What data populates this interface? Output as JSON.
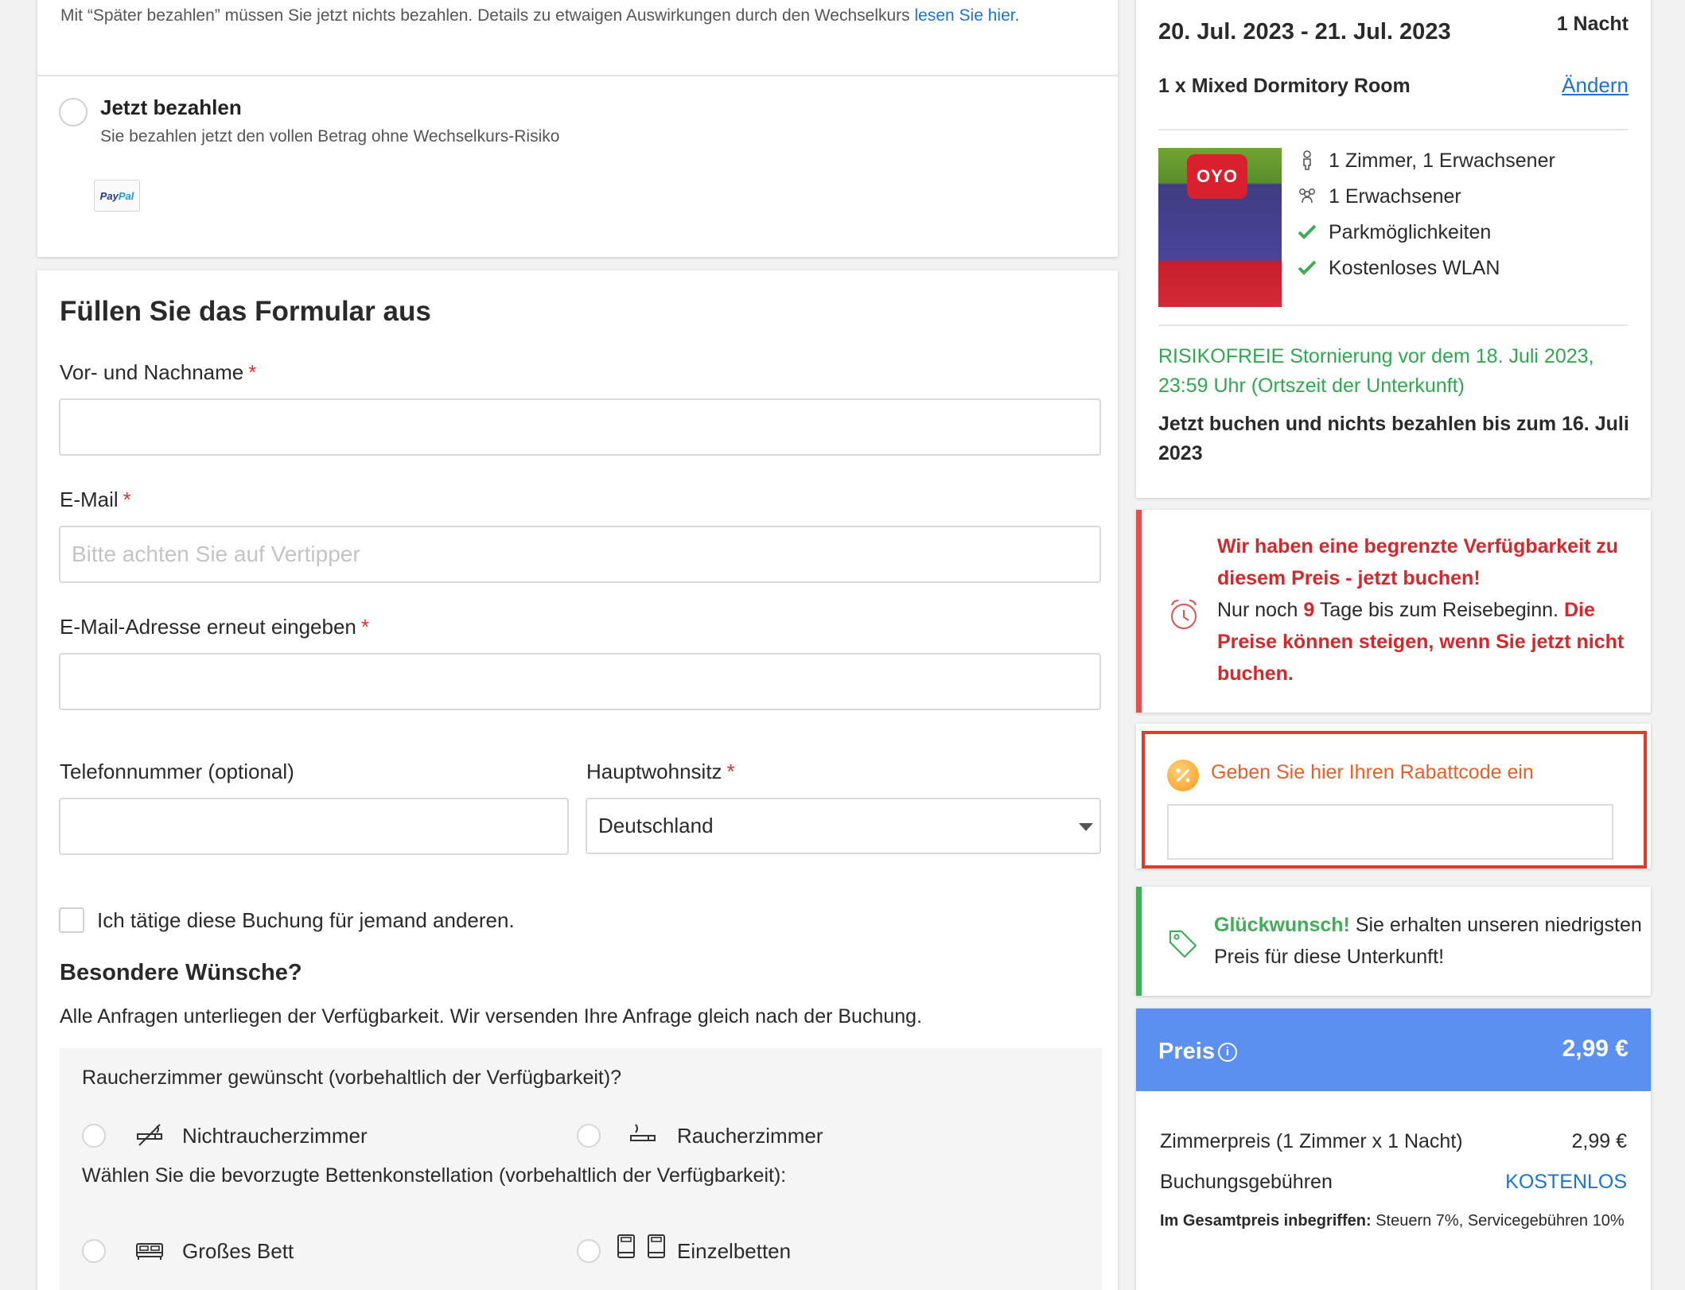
{
  "payment": {
    "later_text": "Mit “Später bezahlen” müssen Sie jetzt nichts bezahlen. Details zu etwaigen Auswirkungen durch den Wechselkurs",
    "later_link": "lesen Sie hier",
    "later_end": ".",
    "now_title": "Jetzt bezahlen",
    "now_subtitle": "Sie bezahlen jetzt den vollen Betrag ohne Wechselkurs-Risiko",
    "paypal_a": "Pay",
    "paypal_b": "Pal"
  },
  "form": {
    "title": "Füllen Sie das Formular aus",
    "name_label": "Vor- und Nachname",
    "email_label": "E-Mail",
    "email_placeholder": "Bitte achten Sie auf Vertipper",
    "email_repeat_label": "E-Mail-Adresse erneut eingeben",
    "phone_label": "Telefonnummer (optional)",
    "residence_label": "Hauptwohnsitz",
    "residence_value": "Deutschland",
    "required_mark": "*",
    "other_person_label": "Ich tätige diese Buchung für jemand anderen.",
    "wishes_title": "Besondere Wünsche?",
    "wishes_note": "Alle Anfragen unterliegen der Verfügbarkeit. Wir versenden Ihre Anfrage gleich nach der Buchung.",
    "smoking_question": "Raucherzimmer gewünscht (vorbehaltlich der Verfügbarkeit)?",
    "non_smoking": "Nichtraucherzimmer",
    "smoking": "Raucherzimmer",
    "bed_question": "Wählen Sie die bevorzugte Bettenkonstellation (vorbehaltlich der Verfügbarkeit):",
    "big_bed": "Großes Bett",
    "single_beds": "Einzelbetten"
  },
  "summary": {
    "dates": "20. Jul. 2023 - 21. Jul. 2023",
    "nights": "1 Nacht",
    "room": "1 x Mixed Dormitory Room",
    "change": "Ändern",
    "photo_logo": "OYO",
    "features": [
      {
        "icon": "person-icon",
        "text": "1 Zimmer, 1 Erwachsener"
      },
      {
        "icon": "group-icon",
        "text": "1 Erwachsener"
      },
      {
        "icon": "check-icon",
        "text": "Parkmöglichkeiten"
      },
      {
        "icon": "check-icon",
        "text": "Kostenloses WLAN"
      }
    ],
    "cancellation": "RISIKOFREIE Stornierung vor dem 18. Juli 2023, 23:59 Uhr (Ortszeit der Unterkunft)",
    "pay_later": "Jetzt buchen und nichts bezahlen bis zum 16. Juli 2023"
  },
  "availability": {
    "headline": "Wir haben eine begrenzte Verfügbarkeit zu diesem Preis - jetzt buchen!",
    "days_prefix": "Nur noch",
    "days_count": "9",
    "days_suffix": "Tage bis zum Reisebeginn.",
    "warning": "Die Preise können steigen, wenn Sie jetzt nicht buchen."
  },
  "discount": {
    "label": "Geben Sie hier Ihren Rabattcode ein"
  },
  "congrats": {
    "highlight": "Glückwunsch!",
    "text": "Sie erhalten unseren niedrigsten Preis für diese Unterkunft!"
  },
  "price": {
    "title": "Preis",
    "info": "i",
    "total": "2,99 €",
    "room_label": "Zimmerpreis (1 Zimmer x 1 Nacht)",
    "room_value": "2,99 €",
    "fees_label": "Buchungsgebühren",
    "fees_value": "KOSTENLOS",
    "tax_bold": "Im Gesamtpreis inbegriffen:",
    "tax_text": "Steuern 7%, Servicegebühren 10%"
  },
  "colors": {
    "link": "#1a73d9",
    "required": "#e0322b",
    "success": "#2fa84f",
    "alert": "#d9262b",
    "price_header": "#5b8ff0",
    "discount": "#e6602a"
  }
}
